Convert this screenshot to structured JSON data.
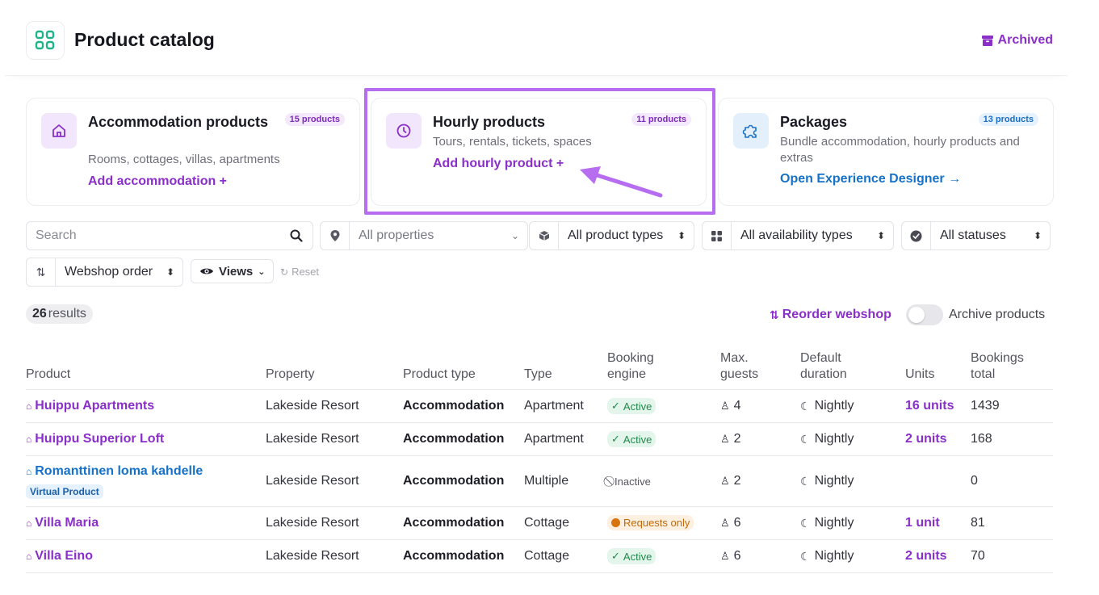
{
  "header": {
    "title": "Product catalog",
    "archived_label": "Archived"
  },
  "cards": [
    {
      "title": "Accommodation products",
      "badge": "15 products",
      "subtitle": "Rooms, cottages, villas, apartments",
      "link": "Add accommodation +",
      "icon": "house-icon"
    },
    {
      "title": "Hourly products",
      "badge": "11 products",
      "subtitle": "Tours, rentals, tickets, spaces",
      "link": "Add hourly product +",
      "icon": "clock-icon"
    },
    {
      "title": "Packages",
      "badge": "13 products",
      "subtitle": "Bundle accommodation, hourly products and extras",
      "link": "Open Experience Designer →",
      "icon": "puzzle-icon"
    }
  ],
  "filters": {
    "search_placeholder": "Search",
    "properties": "All properties",
    "product_types": "All product types",
    "availability_types": "All availability types",
    "statuses": "All statuses",
    "sort": "Webshop order",
    "views": "Views",
    "reset": "Reset"
  },
  "results": {
    "count": "26",
    "label": "results"
  },
  "actions": {
    "reorder": "Reorder webshop",
    "archive_toggle_label": "Archive products"
  },
  "table": {
    "headers": {
      "product": "Product",
      "property": "Property",
      "product_type": "Product type",
      "type": "Type",
      "booking_engine": "Booking engine",
      "max_guests": "Max. guests",
      "default_duration": "Default duration",
      "units": "Units",
      "bookings_total": "Bookings total"
    },
    "rows": [
      {
        "product": "Huippu Apartments",
        "property": "Lakeside Resort",
        "product_type": "Accommodation",
        "type": "Apartment",
        "status": "Active",
        "guests": "4",
        "duration": "Nightly",
        "units": "16 units",
        "bookings": "1439"
      },
      {
        "product": "Huippu Superior Loft",
        "property": "Lakeside Resort",
        "product_type": "Accommodation",
        "type": "Apartment",
        "status": "Active",
        "guests": "2",
        "duration": "Nightly",
        "units": "2 units",
        "bookings": "168"
      },
      {
        "product": "Romanttinen loma kahdelle",
        "badge": "Virtual Product",
        "property": "Lakeside Resort",
        "product_type": "Accommodation",
        "type": "Multiple",
        "status": "Inactive",
        "guests": "2",
        "duration": "Nightly",
        "units": "",
        "bookings": "0"
      },
      {
        "product": "Villa Maria",
        "property": "Lakeside Resort",
        "product_type": "Accommodation",
        "type": "Cottage",
        "status": "Requests only",
        "guests": "6",
        "duration": "Nightly",
        "units": "1 unit",
        "bookings": "81"
      },
      {
        "product": "Villa Eino",
        "property": "Lakeside Resort",
        "product_type": "Accommodation",
        "type": "Cottage",
        "status": "Active",
        "guests": "6",
        "duration": "Nightly",
        "units": "2 units",
        "bookings": "70"
      }
    ]
  },
  "colors": {
    "accent": "#8a2fc8",
    "link_blue": "#1672c9",
    "highlight": "#b66df0"
  }
}
